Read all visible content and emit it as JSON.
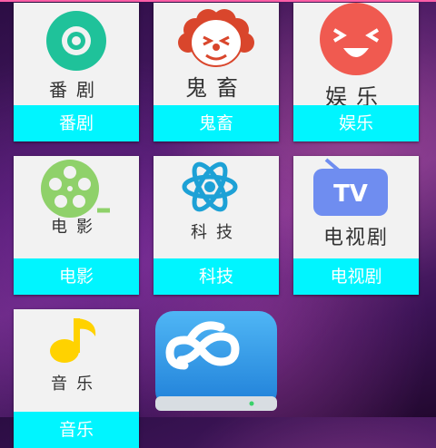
{
  "tiles": [
    {
      "name": "tile-fanju",
      "label": "番剧",
      "caption": "番剧",
      "icon": "disc-icon"
    },
    {
      "name": "tile-guichu",
      "label": "鬼畜",
      "caption": "鬼畜",
      "icon": "clown-face-icon"
    },
    {
      "name": "tile-yule",
      "label": "娱乐",
      "caption": "娱乐",
      "icon": "laughing-face-icon"
    },
    {
      "name": "tile-dianying",
      "label": "电影",
      "caption": "电影",
      "icon": "film-reel-icon"
    },
    {
      "name": "tile-keji",
      "label": "科技",
      "caption": "科技",
      "icon": "atom-icon"
    },
    {
      "name": "tile-dianshiju",
      "label": "电视剧",
      "caption": "电视剧",
      "icon": "tv-icon"
    },
    {
      "name": "tile-yinyue",
      "label": "音乐",
      "caption": "音乐",
      "icon": "music-note-icon"
    }
  ],
  "cloud_app": {
    "icon": "cloud-storage-icon"
  },
  "colors": {
    "accent": "#00f5ff",
    "tile_bg": "#f2f2f2",
    "topbar": "#ff5fa8"
  }
}
